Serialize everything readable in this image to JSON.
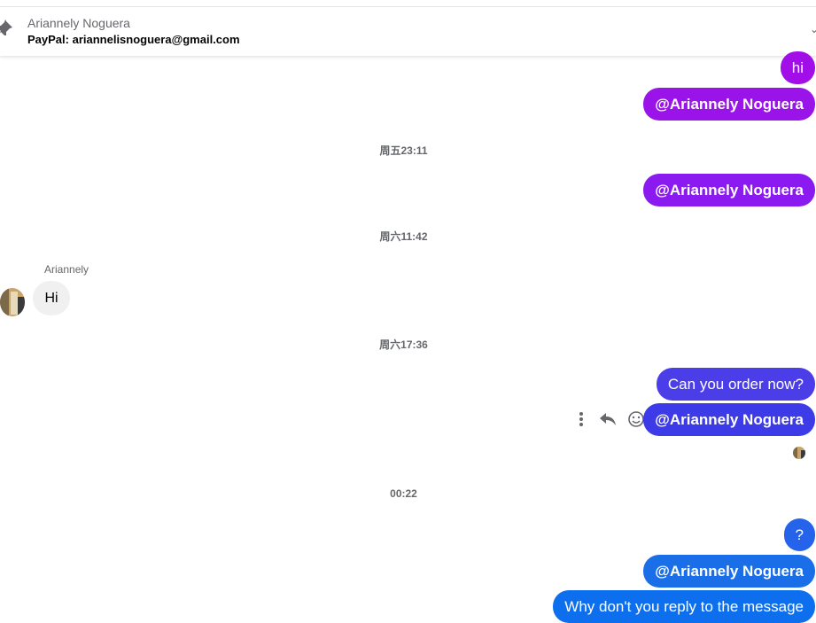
{
  "pinned": {
    "name": "Ariannely Noguera",
    "text": "PayPal: ariannelisnoguera@gmail.com"
  },
  "messages": {
    "hi": "hi",
    "mention1": "@Ariannely Noguera",
    "ts1": "周五23:11",
    "mention2": "@Ariannely Noguera",
    "ts2": "周六11:42",
    "sender": "Ariannely",
    "incoming": "Hi",
    "ts3": "周六17:36",
    "order": "Can you order now?",
    "mention3": "@Ariannely Noguera",
    "ts4": "00:22",
    "question": "?",
    "mention4": "@Ariannely Noguera",
    "reply": "Why don't you reply to the message"
  },
  "icons": {
    "pin": "pin-icon",
    "more": "more-options-icon",
    "reply": "reply-icon",
    "react": "emoji-react-icon"
  },
  "colors": {
    "purple": "#a10ee8",
    "violet_1": "#9a13e9",
    "violet_2": "#8b1af0",
    "indigo": "#4b3ee8",
    "blue_1": "#2563eb",
    "blue_2": "#1a6ee8",
    "blue_3": "#0d6fee"
  }
}
